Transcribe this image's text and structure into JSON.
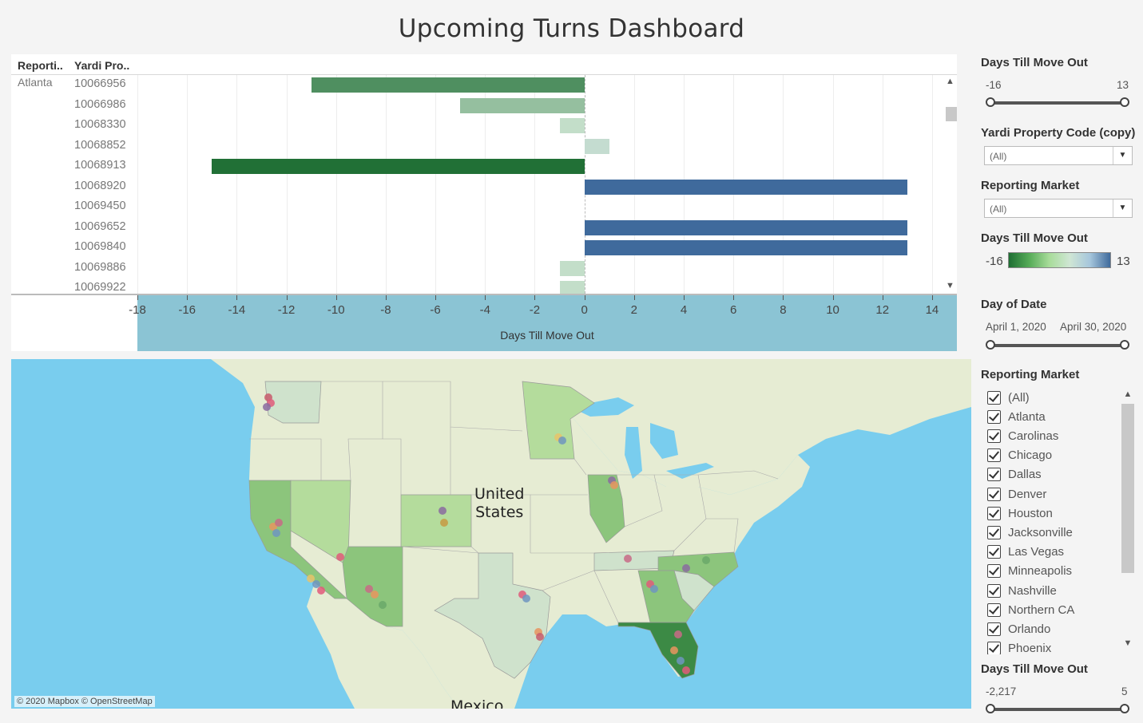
{
  "title": "Upcoming Turns Dashboard",
  "table": {
    "col_market": "Reporti..",
    "col_code": "Yardi Pro..",
    "market": "Atlanta",
    "rows": [
      {
        "code": "10066956",
        "days": -11
      },
      {
        "code": "10066986",
        "days": -5
      },
      {
        "code": "10068330",
        "days": -1
      },
      {
        "code": "10068852",
        "days": 1
      },
      {
        "code": "10068913",
        "days": -15
      },
      {
        "code": "10068920",
        "days": 13
      },
      {
        "code": "10069450",
        "days": 0
      },
      {
        "code": "10069652",
        "days": 13
      },
      {
        "code": "10069840",
        "days": 13
      },
      {
        "code": "10069886",
        "days": -1
      },
      {
        "code": "10069922",
        "days": -1
      }
    ]
  },
  "chart_data": {
    "type": "bar",
    "orientation": "horizontal",
    "categories": [
      "10066956",
      "10066986",
      "10068330",
      "10068852",
      "10068913",
      "10068920",
      "10069450",
      "10069652",
      "10069840",
      "10069886",
      "10069922"
    ],
    "values": [
      -11,
      -5,
      -1,
      1,
      -15,
      13,
      0,
      13,
      13,
      -1,
      -1
    ],
    "xlabel": "Days Till Move Out",
    "xlim": [
      -18,
      15
    ],
    "ticks": [
      "-18",
      "-16",
      "-14",
      "-12",
      "-10",
      "-8",
      "-6",
      "-4",
      "-2",
      "0",
      "2",
      "4",
      "6",
      "8",
      "10",
      "12",
      "14"
    ],
    "color_scale": {
      "min": -16,
      "max": 13,
      "low": "#1e6e33",
      "mid": "#cfe6d4",
      "high": "#3f6a9c"
    }
  },
  "scroll": {
    "up": "▲",
    "down": "▼"
  },
  "map": {
    "country_label": "United States",
    "country_line1": "United",
    "country_line2": "States",
    "neighbor_label": "Mexico",
    "credit": "© 2020 Mapbox © OpenStreetMap",
    "colors": {
      "water": "#79cdee",
      "land": "#e6ecd3",
      "dark": "#3c8a45",
      "mid": "#8cc57c",
      "light": "#b4dc9c",
      "pale": "#cfe2cc"
    }
  },
  "sidebar": {
    "days_filter": {
      "title": "Days Till Move Out",
      "min": "-16",
      "max": "13"
    },
    "property_code": {
      "title": "Yardi Property Code (copy)",
      "value": "(All)"
    },
    "market_dropdown": {
      "title": "Reporting Market",
      "value": "(All)"
    },
    "days_legend": {
      "title": "Days Till Move Out",
      "min": "-16",
      "max": "13"
    },
    "date_filter": {
      "title": "Day of Date",
      "start": "April 1, 2020",
      "end": "April 30, 2020"
    },
    "market_list": {
      "title": "Reporting Market",
      "items": [
        "(All)",
        "Atlanta",
        "Carolinas",
        "Chicago",
        "Dallas",
        "Denver",
        "Houston",
        "Jacksonville",
        "Las Vegas",
        "Minneapolis",
        "Nashville",
        "Northern CA",
        "Orlando",
        "Phoenix"
      ]
    },
    "days_filter2": {
      "title": "Days Till Move Out",
      "min": "-2,217",
      "max": "5"
    },
    "arrow_down": "▼"
  }
}
